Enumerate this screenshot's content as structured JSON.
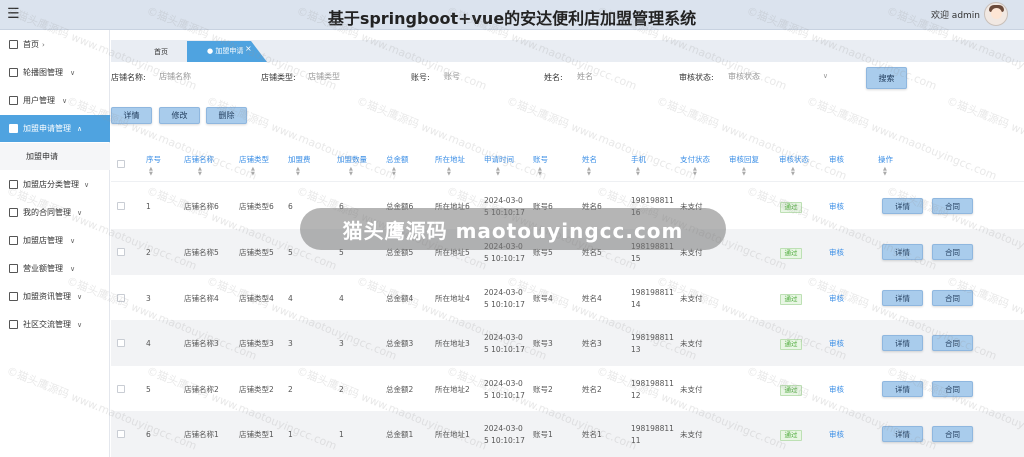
{
  "header": {
    "title": "基于springboot+vue的安达便利店加盟管理系统",
    "welcome": "欢迎 admin",
    "menu_icon": "menu-icon"
  },
  "sidebar": {
    "items": [
      {
        "label": "首页",
        "icon": "home-icon",
        "chevron": "›"
      },
      {
        "label": "轮播图管理",
        "icon": "image-icon",
        "chevron": "∨"
      },
      {
        "label": "用户管理",
        "icon": "user-icon",
        "chevron": "∨"
      },
      {
        "label": "加盟申请管理",
        "icon": "document-icon",
        "chevron": "∧"
      },
      {
        "label": "加盟店分类管理",
        "icon": "category-icon",
        "chevron": "∨"
      },
      {
        "label": "我的合同管理",
        "icon": "contract-icon",
        "chevron": "∨"
      },
      {
        "label": "加盟店管理",
        "icon": "store-icon",
        "chevron": "∨"
      },
      {
        "label": "营业额管理",
        "icon": "money-icon",
        "chevron": "∨"
      },
      {
        "label": "加盟资讯管理",
        "icon": "news-icon",
        "chevron": "∨"
      },
      {
        "label": "社区交流管理",
        "icon": "chat-icon",
        "chevron": "∨"
      }
    ],
    "subitem": "加盟申请"
  },
  "tabs": {
    "home": "首页",
    "active": "● 加盟申请",
    "close": "×"
  },
  "search": {
    "store_name_label": "店铺名称:",
    "store_name_placeholder": "店铺名称",
    "store_type_label": "店铺类型:",
    "store_type_placeholder": "店铺类型",
    "account_label": "账号:",
    "account_placeholder": "账号",
    "name_label": "姓名:",
    "name_placeholder": "姓名",
    "status_label": "审核状态:",
    "status_placeholder": "审核状态",
    "button": "搜索"
  },
  "actions": {
    "detail": "详情",
    "edit": "修改",
    "delete": "删除"
  },
  "table": {
    "headers": [
      "序号",
      "店铺名称",
      "店铺类型",
      "加盟费",
      "加盟数量",
      "总金额",
      "所在地址",
      "申请时间",
      "账号",
      "姓名",
      "手机",
      "支付状态",
      "审核回复",
      "审核状态",
      "审核",
      "操作"
    ],
    "rows": [
      {
        "no": "1",
        "name": "店铺名称6",
        "type": "店铺类型6",
        "fee": "6",
        "qty": "6",
        "total": "总金额6",
        "addr": "所在地址6",
        "time1": "2024-03-0",
        "time2": "5 10:10:17",
        "account": "账号6",
        "person": "姓名6",
        "phone1": "198198811",
        "phone2": "16",
        "pay": "未支付",
        "status": "通过",
        "review": "审核",
        "btn1": "详情",
        "btn2": "合同"
      },
      {
        "no": "2",
        "name": "店铺名称5",
        "type": "店铺类型5",
        "fee": "5",
        "qty": "5",
        "total": "总金额5",
        "addr": "所在地址5",
        "time1": "2024-03-0",
        "time2": "5 10:10:17",
        "account": "账号5",
        "person": "姓名5",
        "phone1": "198198811",
        "phone2": "15",
        "pay": "未支付",
        "status": "通过",
        "review": "审核",
        "btn1": "详情",
        "btn2": "合同"
      },
      {
        "no": "3",
        "name": "店铺名称4",
        "type": "店铺类型4",
        "fee": "4",
        "qty": "4",
        "total": "总金额4",
        "addr": "所在地址4",
        "time1": "2024-03-0",
        "time2": "5 10:10:17",
        "account": "账号4",
        "person": "姓名4",
        "phone1": "198198811",
        "phone2": "14",
        "pay": "未支付",
        "status": "通过",
        "review": "审核",
        "btn1": "详情",
        "btn2": "合同"
      },
      {
        "no": "4",
        "name": "店铺名称3",
        "type": "店铺类型3",
        "fee": "3",
        "qty": "3",
        "total": "总金额3",
        "addr": "所在地址3",
        "time1": "2024-03-0",
        "time2": "5 10:10:17",
        "account": "账号3",
        "person": "姓名3",
        "phone1": "198198811",
        "phone2": "13",
        "pay": "未支付",
        "status": "通过",
        "review": "审核",
        "btn1": "详情",
        "btn2": "合同"
      },
      {
        "no": "5",
        "name": "店铺名称2",
        "type": "店铺类型2",
        "fee": "2",
        "qty": "2",
        "total": "总金额2",
        "addr": "所在地址2",
        "time1": "2024-03-0",
        "time2": "5 10:10:17",
        "account": "账号2",
        "person": "姓名2",
        "phone1": "198198811",
        "phone2": "12",
        "pay": "未支付",
        "status": "通过",
        "review": "审核",
        "btn1": "详情",
        "btn2": "合同"
      },
      {
        "no": "6",
        "name": "店铺名称1",
        "type": "店铺类型1",
        "fee": "1",
        "qty": "1",
        "total": "总金额1",
        "addr": "所在地址1",
        "time1": "2024-03-0",
        "time2": "5 10:10:17",
        "account": "账号1",
        "person": "姓名1",
        "phone1": "198198811",
        "phone2": "11",
        "pay": "未支付",
        "status": "通过",
        "review": "审核",
        "btn1": "详情",
        "btn2": "合同"
      }
    ]
  },
  "overlay_text": "猫头鹰源码 maotouyingcc.com",
  "watermark": "©猫头鹰源码 www.maotouyingcc.com",
  "colors": {
    "accent": "#4fa3e0",
    "button": "#a9ccec",
    "header": "#dbe3ee",
    "link": "#3a8ee6",
    "pass": "#4caa3a"
  }
}
